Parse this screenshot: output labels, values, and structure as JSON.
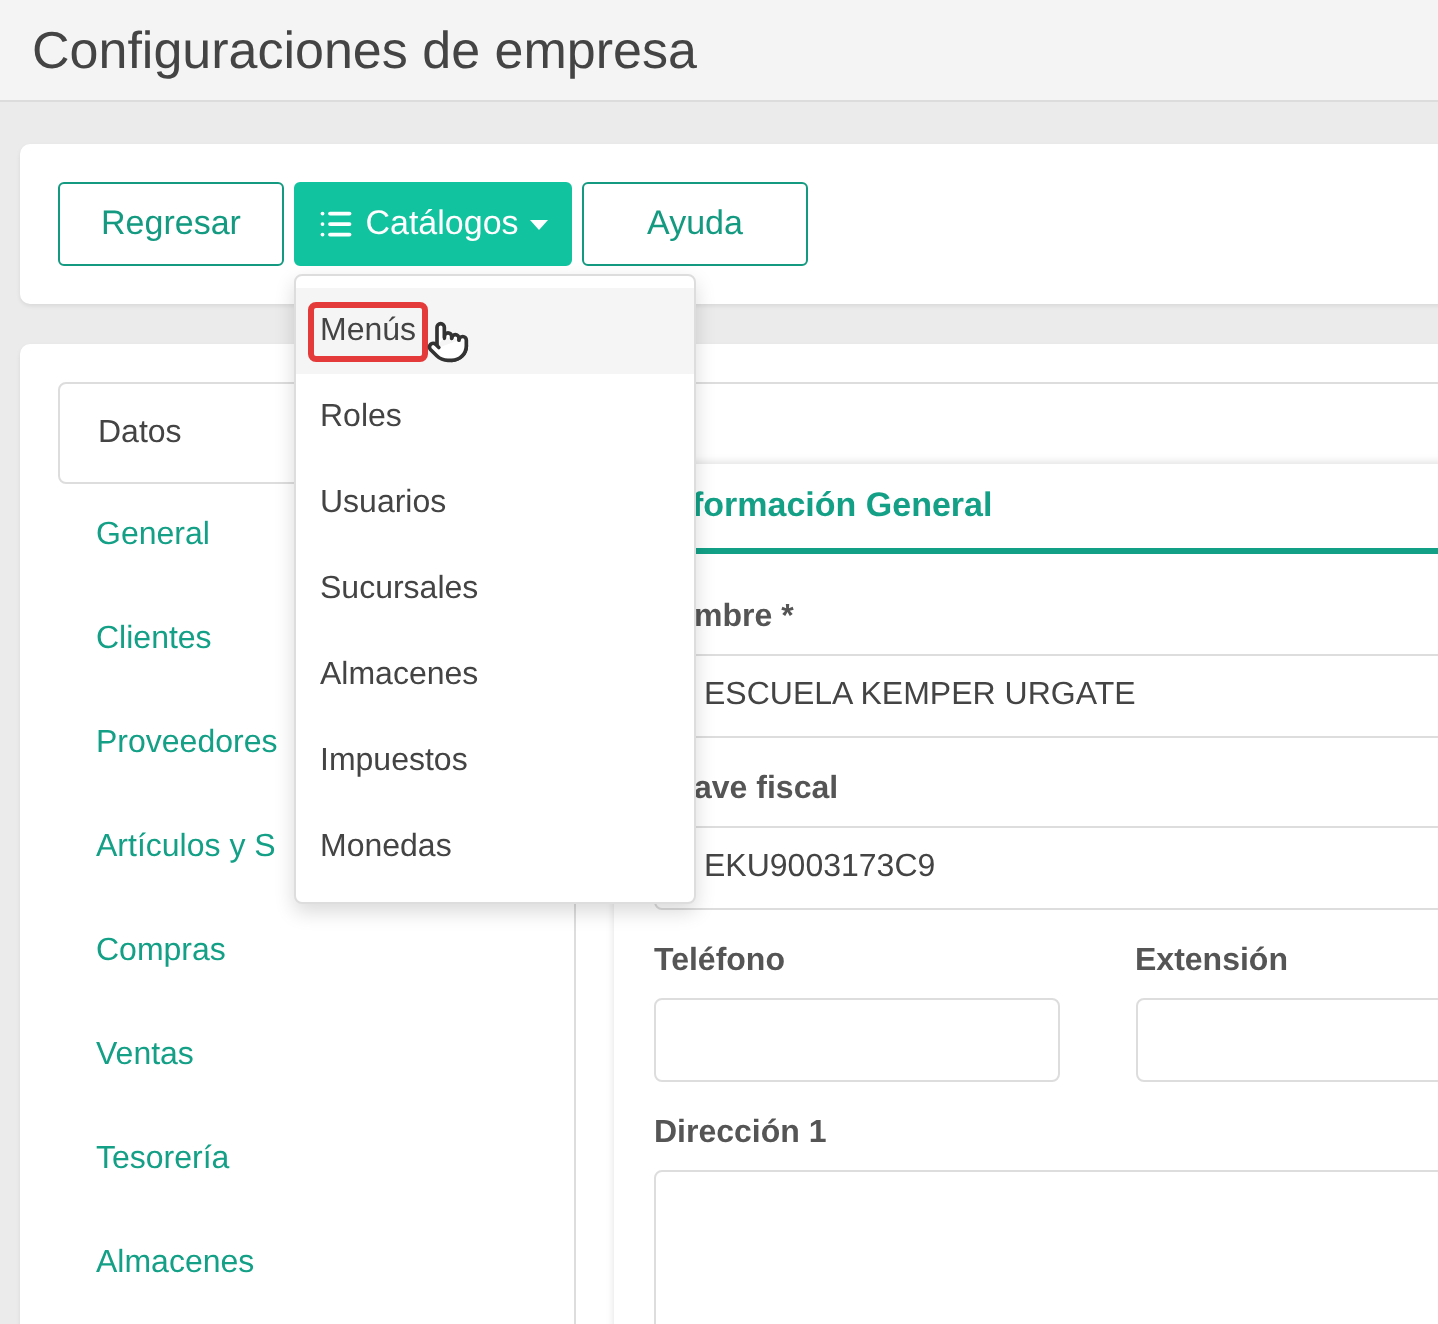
{
  "page_title": "Configuraciones de empresa",
  "toolbar": {
    "buttons": [
      {
        "label": "Regresar",
        "kind": "outline"
      },
      {
        "label": "Catálogos",
        "kind": "dropdown"
      },
      {
        "label": "Ayuda",
        "kind": "outline"
      }
    ]
  },
  "catalog_menu": {
    "items": [
      {
        "label": "Menús",
        "selected": true
      },
      {
        "label": "Roles",
        "selected": false
      },
      {
        "label": "Usuarios",
        "selected": false
      },
      {
        "label": "Sucursales",
        "selected": false
      },
      {
        "label": "Almacenes",
        "selected": false
      },
      {
        "label": "Impuestos",
        "selected": false
      },
      {
        "label": "Monedas",
        "selected": false
      }
    ]
  },
  "sidebar": {
    "items": [
      {
        "label": "Datos",
        "selected": true
      },
      {
        "label": "General",
        "selected": false
      },
      {
        "label": "Clientes",
        "selected": false
      },
      {
        "label": "Proveedores",
        "selected": false
      },
      {
        "label": "Artículos y S",
        "selected": false
      },
      {
        "label": "Compras",
        "selected": false
      },
      {
        "label": "Ventas",
        "selected": false
      },
      {
        "label": "Tesorería",
        "selected": false
      },
      {
        "label": "Almacenes",
        "selected": false
      }
    ]
  },
  "panel": {
    "title": "formación General",
    "rows": [
      {
        "fields": [
          {
            "label": "mbre *",
            "value": "ESCUELA KEMPER URGATE"
          }
        ]
      },
      {
        "fields": [
          {
            "label": "ave fiscal",
            "value": "EKU9003173C9"
          }
        ]
      },
      {
        "fields": [
          {
            "label": "Teléfono"
          },
          {
            "label": "Extensión"
          }
        ]
      },
      {
        "fields": [
          {
            "label": "Dirección 1",
            "kind": "textarea"
          }
        ]
      }
    ]
  }
}
